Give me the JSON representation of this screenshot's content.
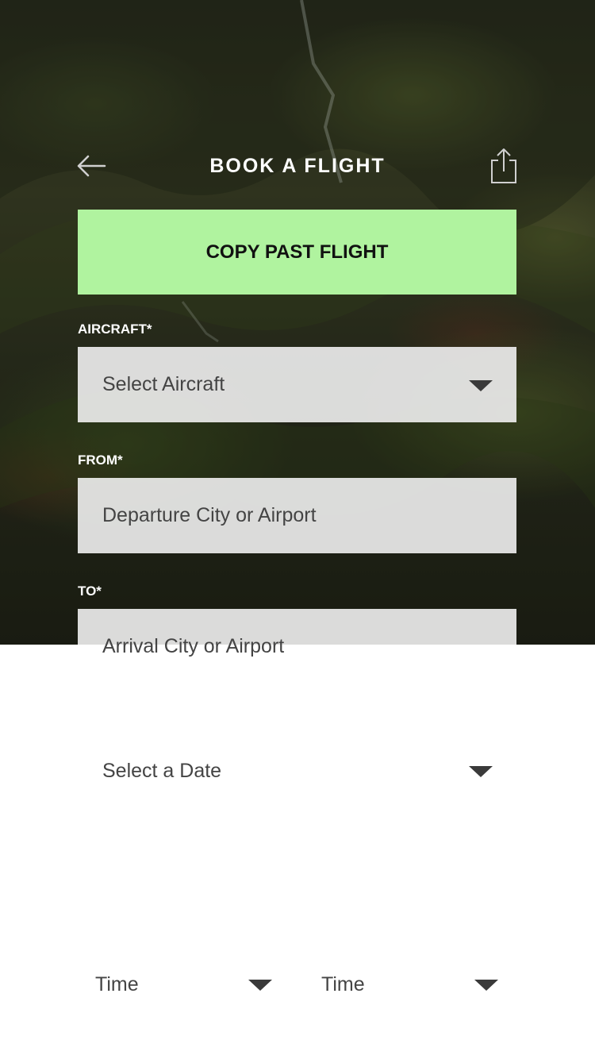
{
  "header": {
    "title": "BOOK A FLIGHT",
    "back_icon": "arrow-left-icon",
    "share_icon": "share-icon"
  },
  "copy_button": {
    "label": "COPY PAST FLIGHT",
    "color": "#b0f39f"
  },
  "aircraft": {
    "label": "AIRCRAFT*",
    "placeholder": "Select Aircraft",
    "icon": "chevron-down-icon"
  },
  "from": {
    "label": "FROM*",
    "placeholder": "Departure City or Airport"
  },
  "to": {
    "label": "TO*",
    "placeholder": "Arrival City or Airport"
  },
  "date": {
    "placeholder": "Select a Date",
    "icon": "chevron-down-icon"
  },
  "times": [
    {
      "placeholder": "Time",
      "icon": "chevron-down-icon"
    },
    {
      "placeholder": "Time",
      "icon": "chevron-down-icon"
    }
  ]
}
